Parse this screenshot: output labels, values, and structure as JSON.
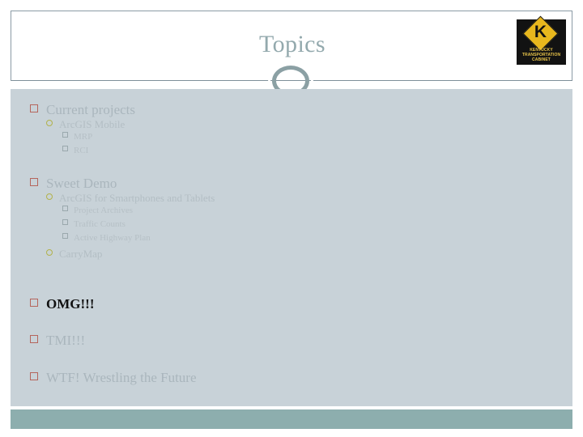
{
  "slide": {
    "title": "Topics",
    "title_color": "#93a9ad",
    "body_background": "#c8d2d8",
    "footer_color": "#8daeae"
  },
  "logo": {
    "monogram": "K",
    "caption_line1": "KENTUCKY",
    "caption_line2": "TRANSPORTATION",
    "caption_line3": "CABINET",
    "diamond_color": "#e8b71d",
    "plate_color": "#121212"
  },
  "outline": [
    {
      "level": 1,
      "text": "Current projects",
      "emphasis": false
    },
    {
      "level": 2,
      "text": "ArcGIS Mobile",
      "emphasis": false
    },
    {
      "level": 3,
      "text": "MRP",
      "emphasis": false
    },
    {
      "level": 3,
      "text": "RCI",
      "emphasis": false
    },
    {
      "level": 1,
      "text": "Sweet Demo",
      "emphasis": false
    },
    {
      "level": 2,
      "text": "ArcGIS for Smartphones and Tablets",
      "emphasis": false
    },
    {
      "level": 3,
      "text": "Project Archives",
      "emphasis": false
    },
    {
      "level": 3,
      "text": "Traffic Counts",
      "emphasis": false
    },
    {
      "level": 3,
      "text": "Active Highway Plan",
      "emphasis": false
    },
    {
      "level": 2,
      "text": "CarryMap",
      "emphasis": false
    },
    {
      "level": 1,
      "text": "OMG!!!",
      "emphasis": true
    },
    {
      "level": 1,
      "text": "TMI!!!",
      "emphasis": false
    },
    {
      "level": 1,
      "text": "WTF! Wrestling the Future",
      "emphasis": false
    }
  ]
}
